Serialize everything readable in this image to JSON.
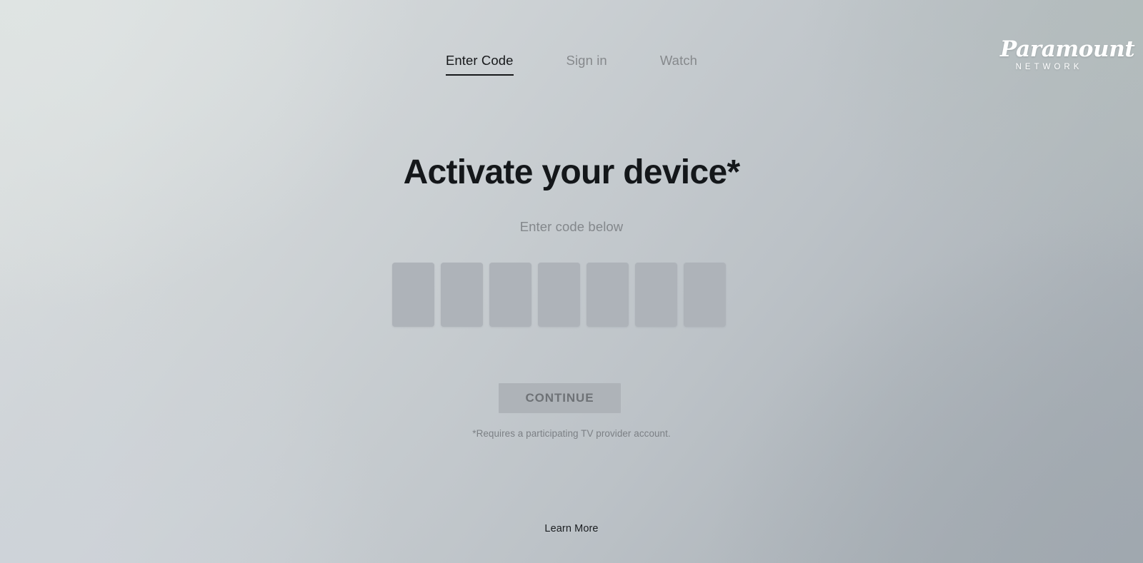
{
  "brand": {
    "wordmark": "Paramount",
    "subword": "NETWORK",
    "logo_color": "#ffffff"
  },
  "nav": {
    "tabs": [
      {
        "label": "Enter Code",
        "active": true,
        "name": "tab-enter-code"
      },
      {
        "label": "Sign in",
        "active": false,
        "name": "tab-sign-in"
      },
      {
        "label": "Watch",
        "active": false,
        "name": "tab-watch"
      }
    ],
    "active_color": "#16181a",
    "inactive_color": "#86898c"
  },
  "main": {
    "title": "Activate your device*",
    "subtitle": "Enter code below",
    "code_input": {
      "length": 7,
      "values": [
        "",
        "",
        "",
        "",
        "",
        "",
        ""
      ],
      "placeholder": "",
      "box_color": "#aeb3b9"
    },
    "continue_button": {
      "label": "CONTINUE",
      "disabled": true,
      "background": "#aeb3b8",
      "text_color": "#6e7276"
    },
    "footnote": "*Requires a participating TV provider account."
  },
  "footer": {
    "learn_more_label": "Learn More"
  },
  "background": {
    "top_left": "#dde1e1",
    "top_right": "#b3bcbc",
    "bottom_left": "#ced3d9",
    "bottom_right": "#a2a9b0"
  }
}
